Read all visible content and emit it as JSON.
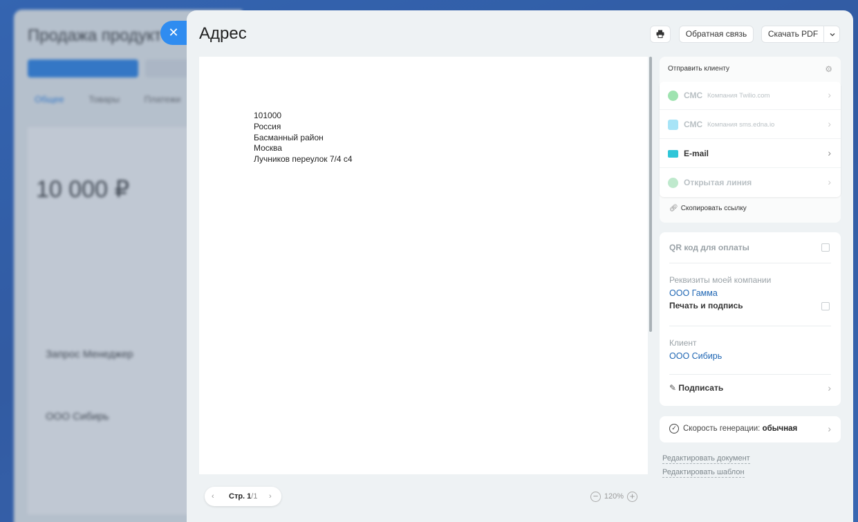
{
  "background": {
    "title": "Продажа продукт",
    "tabs": [
      "Общее",
      "Товары",
      "Платежи"
    ],
    "amount": "10 000 ₽",
    "company": "Запрос Менеджер",
    "client": "ООО Сибирь"
  },
  "slider": {
    "title": "Адрес",
    "close_icon": "close-icon",
    "print_icon": "printer-icon",
    "feedback_label": "Обратная связь",
    "download_label": "Скачать PDF"
  },
  "document": {
    "lines": [
      "101000",
      "Россия",
      "Басманный район",
      "Москва",
      "Лучников переулок 7/4 с4"
    ]
  },
  "pager": {
    "label": "Стр. 1",
    "total": "/1"
  },
  "zoom": {
    "value": "120%"
  },
  "send": {
    "title": "Отправить клиенту",
    "channels": [
      {
        "name": "СМС",
        "sub": "Компания Twilio.com",
        "icon": "whatsapp-icon",
        "color": "#25d366",
        "enabled": false
      },
      {
        "name": "СМС",
        "sub": "Компания sms.edna.io",
        "icon": "chat-icon",
        "color": "#2fc6f6",
        "enabled": false
      },
      {
        "name": "E-mail",
        "sub": "",
        "icon": "mail-icon",
        "color": "#2fc6d8",
        "enabled": true
      },
      {
        "name": "Открытая линия",
        "sub": "",
        "icon": "open-line-icon",
        "color": "#9ee3b8",
        "enabled": false
      }
    ],
    "copy_link": "Скопировать ссылку"
  },
  "options": {
    "qr_label": "QR код для оплаты",
    "requisites_label": "Реквизиты моей компании",
    "my_company": "ООО Гамма",
    "stamp_label": "Печать и подпись",
    "client_label": "Клиент",
    "client_value": "ООО Сибирь",
    "sign_label": "Подписать"
  },
  "speed": {
    "label": "Скорость генерации:",
    "value": "обычная"
  },
  "links": {
    "edit_document": "Редактировать документ",
    "edit_template": "Редактировать шаблон"
  },
  "colors": {
    "accent": "#2f8cf0",
    "link": "#1d65b3",
    "panel_bg": "#eef2f4"
  }
}
